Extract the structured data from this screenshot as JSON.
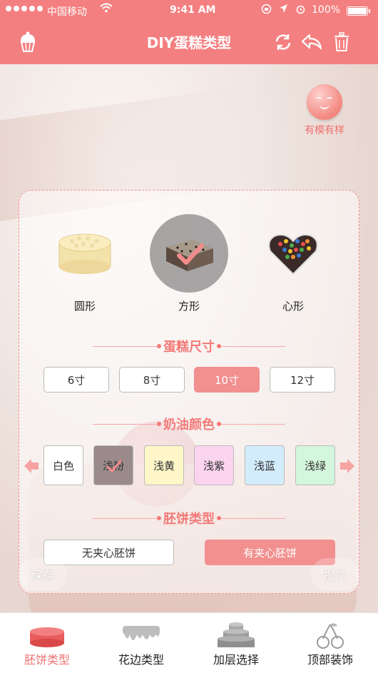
{
  "status_bar": {
    "carrier": "中国移动",
    "time": "9:41 AM",
    "battery_pct": "100%"
  },
  "header": {
    "title": "DIY蛋糕类型",
    "left_icon": "cupcake-icon",
    "right_icons": [
      "refresh-icon",
      "undo-icon",
      "trash-icon"
    ]
  },
  "mascot": {
    "label": "有模有样"
  },
  "shapes": {
    "items": [
      {
        "label": "圆形",
        "icon": "round-cake-icon"
      },
      {
        "label": "方形",
        "icon": "square-cake-icon",
        "selected": true
      },
      {
        "label": "心形",
        "icon": "heart-cake-icon"
      }
    ]
  },
  "size": {
    "title": "蛋糕尺寸",
    "options": [
      "6寸",
      "8寸",
      "10寸",
      "12寸"
    ],
    "selected": "10寸"
  },
  "cream": {
    "title": "奶油颜色",
    "options": [
      {
        "label": "白色",
        "color": "#ffffff"
      },
      {
        "label": "浅粉",
        "color": "#9a8a8b",
        "selected": true
      },
      {
        "label": "浅黄",
        "color": "#fff6c9"
      },
      {
        "label": "浅紫",
        "color": "#fbd4ef"
      },
      {
        "label": "浅蓝",
        "color": "#d3ecfb"
      },
      {
        "label": "浅绿",
        "color": "#d4f6dc"
      }
    ]
  },
  "base": {
    "title": "胚饼类型",
    "options": [
      "无夹心胚饼",
      "有夹心胚饼"
    ],
    "selected": "有夹心胚饼"
  },
  "actions": {
    "save": "保存",
    "submit": "提交"
  },
  "tabs": [
    {
      "label": "胚饼类型",
      "icon": "cake-base-icon",
      "active": true
    },
    {
      "label": "花边类型",
      "icon": "cream-drip-icon"
    },
    {
      "label": "加层选择",
      "icon": "layer-cake-icon"
    },
    {
      "label": "顶部装饰",
      "icon": "cherry-icon"
    }
  ],
  "colors": {
    "brand": "#f47f80",
    "accent_text": "#f37a78",
    "selected_btn": "#f28f8f"
  }
}
